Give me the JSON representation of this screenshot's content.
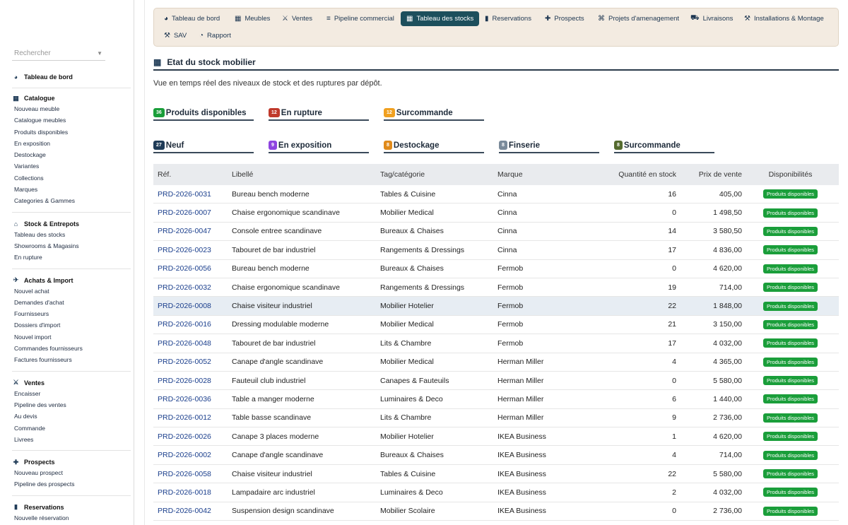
{
  "sidebar": {
    "search_placeholder": "Rechercher",
    "dashboard": "Tableau de bord",
    "sections": [
      {
        "title": "Catalogue",
        "icon": "grid-icon",
        "items": [
          "Nouveau meuble",
          "Catalogue meubles",
          "Produits disponibles",
          "En exposition",
          "Destockage",
          "Variantes",
          "Collections",
          "Marques",
          "Categories & Gammes"
        ]
      },
      {
        "title": "Stock & Entrepots",
        "icon": "warehouse-icon",
        "items": [
          "Tableau des stocks",
          "Showrooms & Magasins",
          "En rupture"
        ]
      },
      {
        "title": "Achats & Import",
        "icon": "plane-icon",
        "items": [
          "Nouvel achat",
          "Demandes d'achat",
          "Fournisseurs",
          "Dossiers d'import",
          "Nouvel import",
          "Commandes fournisseurs",
          "Factures fournisseurs"
        ]
      },
      {
        "title": "Ventes",
        "icon": "handshake-icon",
        "items": [
          "Encaisser",
          "Pipeline des ventes",
          "Au devis",
          "Commande",
          "Livrees"
        ]
      },
      {
        "title": "Prospects",
        "icon": "user-plus-icon",
        "items": [
          "Nouveau prospect",
          "Pipeline des prospects"
        ]
      },
      {
        "title": "Reservations",
        "icon": "bookmark-icon",
        "items": [
          "Nouvelle réservation"
        ]
      }
    ]
  },
  "topnav": {
    "tabs": [
      {
        "label": "Tableau de bord",
        "icon": "gauge-icon"
      },
      {
        "label": "Meubles",
        "icon": "grid-icon"
      },
      {
        "label": "Ventes",
        "icon": "handshake-icon"
      },
      {
        "label": "Pipeline commercial",
        "icon": "list-icon"
      },
      {
        "label": "Tableau des stocks",
        "icon": "table-icon"
      },
      {
        "label": "Reservations",
        "icon": "bookmark-icon"
      },
      {
        "label": "Prospects",
        "icon": "user-plus-icon"
      },
      {
        "label": "Projets d'amenagement",
        "icon": "nodes-icon"
      },
      {
        "label": "Livraisons",
        "icon": "truck-icon"
      },
      {
        "label": "Installations & Montage",
        "icon": "tools-icon"
      },
      {
        "label": "SAV",
        "icon": "wrench-icon"
      },
      {
        "label": "Rapport",
        "icon": "pie-icon"
      }
    ],
    "active": "Tableau des stocks"
  },
  "page": {
    "title": "Etat du stock mobilier",
    "subtitle": "Vue en temps réel des niveaux de stock et des ruptures par dépôt."
  },
  "stats_row1": [
    {
      "count": "36",
      "label": "Produits disponibles",
      "color": "#1a9e3a"
    },
    {
      "count": "12",
      "label": "En rupture",
      "color": "#c0392b"
    },
    {
      "count": "12",
      "label": "Surcommande",
      "color": "#f0a020"
    }
  ],
  "stats_row2": [
    {
      "count": "27",
      "label": "Neuf",
      "color": "#1f3b57"
    },
    {
      "count": "9",
      "label": "En exposition",
      "color": "#8e44e0"
    },
    {
      "count": "8",
      "label": "Destockage",
      "color": "#e08a1a"
    },
    {
      "count": "8",
      "label": "Finserie",
      "color": "#7a8a9a"
    },
    {
      "count": "8",
      "label": "Surcommande",
      "color": "#556b2f"
    }
  ],
  "table": {
    "headers": [
      "Réf.",
      "Libellé",
      "Tag/catégorie",
      "Marque",
      "Quantité en stock",
      "Prix de vente",
      "Disponibilités"
    ],
    "rows": [
      {
        "ref": "PRD-2026-0031",
        "label": "Bureau bench moderne",
        "tag": "Tables & Cuisine",
        "brand": "Cinna",
        "qty": "16",
        "price": "405,00",
        "status": "Produits disponibles"
      },
      {
        "ref": "PRD-2026-0007",
        "label": "Chaise ergonomique scandinave",
        "tag": "Mobilier Medical",
        "brand": "Cinna",
        "qty": "0",
        "price": "1 498,50",
        "status": "Produits disponibles"
      },
      {
        "ref": "PRD-2026-0047",
        "label": "Console entree scandinave",
        "tag": "Bureaux & Chaises",
        "brand": "Cinna",
        "qty": "14",
        "price": "3 580,50",
        "status": "Produits disponibles"
      },
      {
        "ref": "PRD-2026-0023",
        "label": "Tabouret de bar industriel",
        "tag": "Rangements & Dressings",
        "brand": "Cinna",
        "qty": "17",
        "price": "4 836,00",
        "status": "Produits disponibles"
      },
      {
        "ref": "PRD-2026-0056",
        "label": "Bureau bench moderne",
        "tag": "Bureaux & Chaises",
        "brand": "Fermob",
        "qty": "0",
        "price": "4 620,00",
        "status": "Produits disponibles"
      },
      {
        "ref": "PRD-2026-0032",
        "label": "Chaise ergonomique scandinave",
        "tag": "Rangements & Dressings",
        "brand": "Fermob",
        "qty": "19",
        "price": "714,00",
        "status": "Produits disponibles"
      },
      {
        "ref": "PRD-2026-0008",
        "label": "Chaise visiteur industriel",
        "tag": "Mobilier Hotelier",
        "brand": "Fermob",
        "qty": "22",
        "price": "1 848,00",
        "status": "Produits disponibles",
        "hl": true
      },
      {
        "ref": "PRD-2026-0016",
        "label": "Dressing modulable moderne",
        "tag": "Mobilier Medical",
        "brand": "Fermob",
        "qty": "21",
        "price": "3 150,00",
        "status": "Produits disponibles"
      },
      {
        "ref": "PRD-2026-0048",
        "label": "Tabouret de bar industriel",
        "tag": "Lits & Chambre",
        "brand": "Fermob",
        "qty": "17",
        "price": "4 032,00",
        "status": "Produits disponibles"
      },
      {
        "ref": "PRD-2026-0052",
        "label": "Canape d'angle scandinave",
        "tag": "Mobilier Medical",
        "brand": "Herman Miller",
        "qty": "4",
        "price": "4 365,00",
        "status": "Produits disponibles"
      },
      {
        "ref": "PRD-2026-0028",
        "label": "Fauteuil club industriel",
        "tag": "Canapes & Fauteuils",
        "brand": "Herman Miller",
        "qty": "0",
        "price": "5 580,00",
        "status": "Produits disponibles"
      },
      {
        "ref": "PRD-2026-0036",
        "label": "Table a manger moderne",
        "tag": "Luminaires & Deco",
        "brand": "Herman Miller",
        "qty": "6",
        "price": "1 440,00",
        "status": "Produits disponibles"
      },
      {
        "ref": "PRD-2026-0012",
        "label": "Table basse scandinave",
        "tag": "Lits & Chambre",
        "brand": "Herman Miller",
        "qty": "9",
        "price": "2 736,00",
        "status": "Produits disponibles"
      },
      {
        "ref": "PRD-2026-0026",
        "label": "Canape 3 places moderne",
        "tag": "Mobilier Hotelier",
        "brand": "IKEA Business",
        "qty": "1",
        "price": "4 620,00",
        "status": "Produits disponibles"
      },
      {
        "ref": "PRD-2026-0002",
        "label": "Canape d'angle scandinave",
        "tag": "Bureaux & Chaises",
        "brand": "IKEA Business",
        "qty": "4",
        "price": "714,00",
        "status": "Produits disponibles"
      },
      {
        "ref": "PRD-2026-0058",
        "label": "Chaise visiteur industriel",
        "tag": "Tables & Cuisine",
        "brand": "IKEA Business",
        "qty": "22",
        "price": "5 580,00",
        "status": "Produits disponibles"
      },
      {
        "ref": "PRD-2026-0018",
        "label": "Lampadaire arc industriel",
        "tag": "Luminaires & Deco",
        "brand": "IKEA Business",
        "qty": "2",
        "price": "4 032,00",
        "status": "Produits disponibles"
      },
      {
        "ref": "PRD-2026-0042",
        "label": "Suspension design scandinave",
        "tag": "Mobilier Scolaire",
        "brand": "IKEA Business",
        "qty": "0",
        "price": "2 736,00",
        "status": "Produits disponibles"
      }
    ]
  },
  "colors": {
    "accent": "#1d4f5c",
    "nav_bg": "#f3ebe1",
    "link": "#1a3e8c",
    "pill": "#1a9e3a"
  }
}
